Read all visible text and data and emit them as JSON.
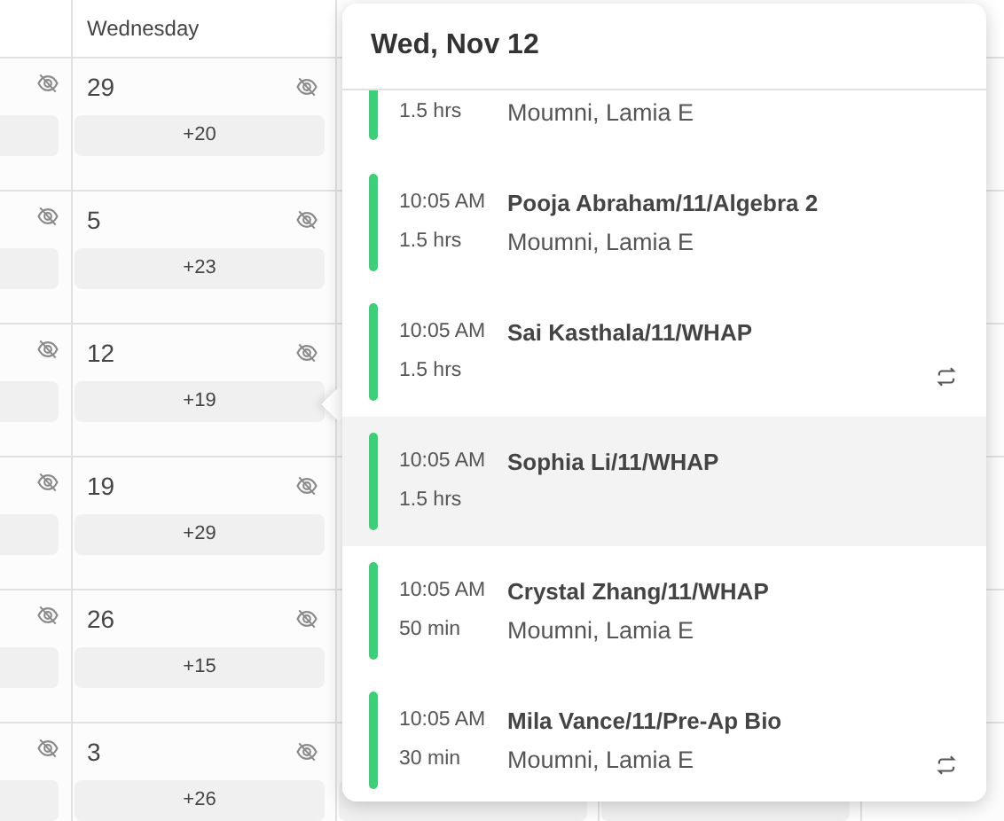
{
  "calendar": {
    "column_header": "Wednesday",
    "weeks": [
      {
        "day": "29",
        "more": "+20"
      },
      {
        "day": "5",
        "more": "+23"
      },
      {
        "day": "12",
        "more": "+19"
      },
      {
        "day": "19",
        "more": "+29"
      },
      {
        "day": "26",
        "more": "+15"
      },
      {
        "day": "3",
        "more": "+26"
      }
    ]
  },
  "popup": {
    "title": "Wed, Nov 12",
    "events": [
      {
        "clipped": true,
        "duration": "1.5 hrs",
        "organizer": "Moumni, Lamia E",
        "recurring": false,
        "selected": false
      },
      {
        "clipped": false,
        "time": "10:05 AM",
        "title": "Pooja Abraham/11/Algebra 2",
        "duration": "1.5 hrs",
        "organizer": "Moumni, Lamia E",
        "recurring": false,
        "selected": false
      },
      {
        "clipped": false,
        "time": "10:05 AM",
        "title": "Sai Kasthala/11/WHAP",
        "duration": "1.5 hrs",
        "recurring": true,
        "selected": false
      },
      {
        "clipped": false,
        "time": "10:05 AM",
        "title": "Sophia Li/11/WHAP",
        "duration": "1.5 hrs",
        "recurring": false,
        "selected": true
      },
      {
        "clipped": false,
        "time": "10:05 AM",
        "title": "Crystal Zhang/11/WHAP",
        "duration": "50 min",
        "organizer": "Moumni, Lamia E",
        "recurring": false,
        "selected": false
      },
      {
        "clipped": false,
        "time": "10:05 AM",
        "title": "Mila Vance/11/Pre-Ap Bio",
        "duration": "30 min",
        "organizer": "Moumni, Lamia E",
        "recurring": true,
        "selected": false
      }
    ]
  }
}
